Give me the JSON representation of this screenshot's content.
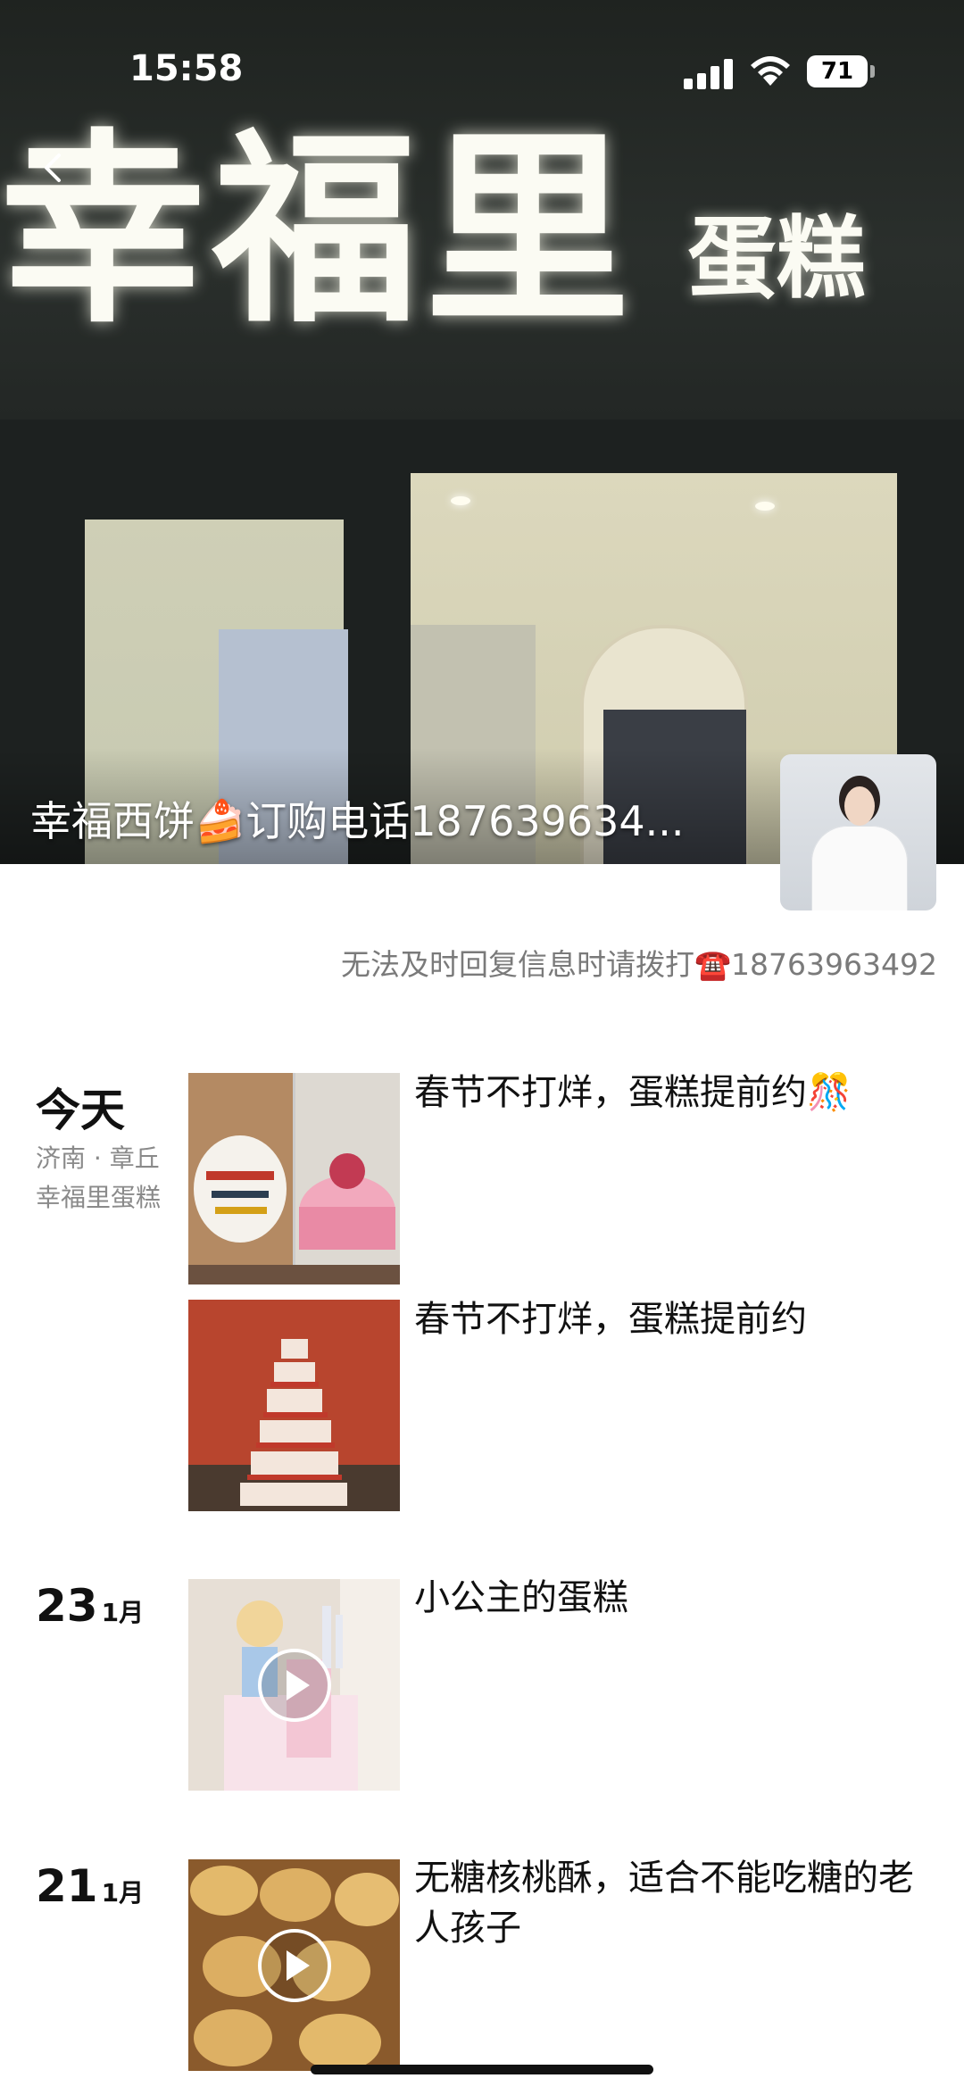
{
  "status_bar": {
    "time": "15:58",
    "battery": "71"
  },
  "cover": {
    "sign_main": "幸福里",
    "sign_sub": "蛋糕",
    "title": "幸福西饼🍰订购电话187639634..."
  },
  "profile": {
    "signature": "无法及时回复信息时请拨打☎️18763963492"
  },
  "feed": {
    "group1": {
      "day": "今天",
      "location_city": "济南 · 章丘",
      "location_place": "幸福里蛋糕",
      "post1_text": "春节不打烊，蛋糕提前约🎊",
      "post2_text": "春节不打烊，蛋糕提前约"
    },
    "group2": {
      "day": "23",
      "month": "1月",
      "post_text": "小公主的蛋糕"
    },
    "group3": {
      "day": "21",
      "month": "1月",
      "post_text": "无糖核桃酥，适合不能吃糖的老人孩子"
    }
  }
}
